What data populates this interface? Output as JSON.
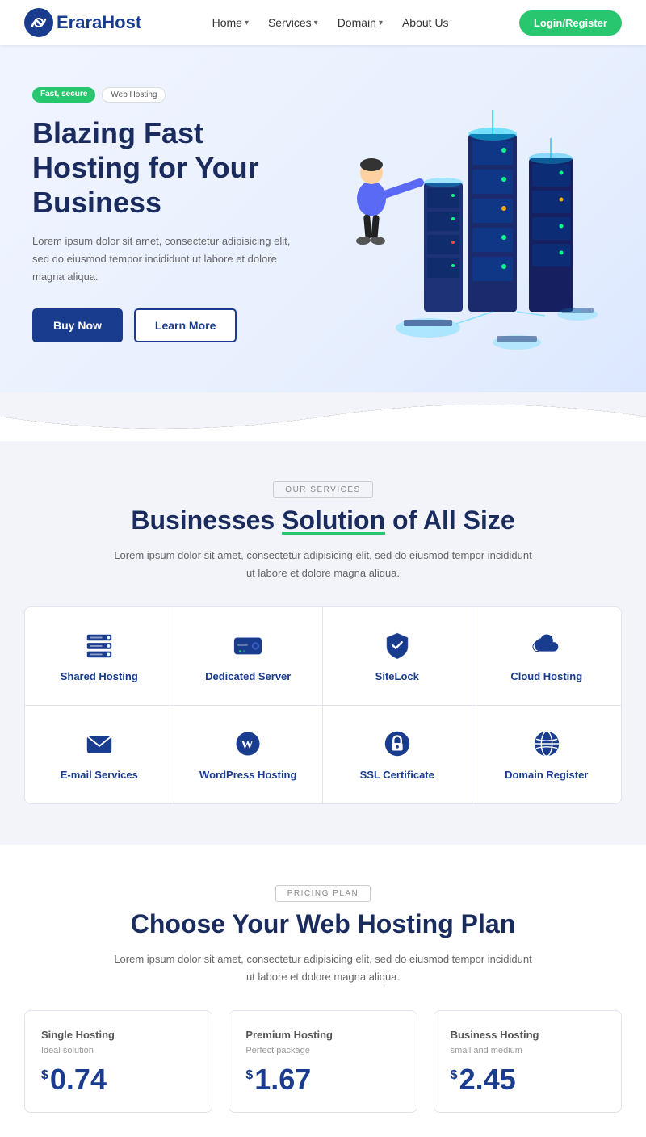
{
  "navbar": {
    "logo_text": "raHost",
    "nav_items": [
      {
        "label": "Home",
        "has_dropdown": true
      },
      {
        "label": "Services",
        "has_dropdown": true
      },
      {
        "label": "Domain",
        "has_dropdown": true
      },
      {
        "label": "About Us",
        "has_dropdown": false
      }
    ],
    "login_label": "Login/Register"
  },
  "hero": {
    "badge_fast": "Fast, secure",
    "badge_web": "Web Hosting",
    "title": "Blazing Fast Hosting for Your Business",
    "description": "Lorem ipsum dolor sit amet, consectetur adipisicing elit, sed do eiusmod tempor incididunt ut labore et dolore magna aliqua.",
    "btn_buy": "Buy Now",
    "btn_learn": "Learn More"
  },
  "services": {
    "section_label": "OUR SERVICES",
    "title_part1": "Businesses ",
    "title_highlight": "Solution",
    "title_part2": " of All Size",
    "description": "Lorem ipsum dolor sit amet, consectetur adipisicing elit, sed do eiusmod tempor incididunt ut labore et dolore magna aliqua.",
    "cards": [
      {
        "name": "Shared Hosting",
        "icon": "server"
      },
      {
        "name": "Dedicated Server",
        "icon": "hdd"
      },
      {
        "name": "SiteLock",
        "icon": "shield"
      },
      {
        "name": "Cloud Hosting",
        "icon": "cloud"
      },
      {
        "name": "E-mail Services",
        "icon": "envelope"
      },
      {
        "name": "WordPress Hosting",
        "icon": "wordpress"
      },
      {
        "name": "SSL Certificate",
        "icon": "lock"
      },
      {
        "name": "Domain Register",
        "icon": "globe"
      }
    ]
  },
  "pricing": {
    "section_label": "PRICING PLAN",
    "title": "Choose Your Web Hosting Plan",
    "description": "Lorem ipsum dolor sit amet, consectetur adipisicing elit, sed do eiusmod tempor incididunt ut labore et dolore magna aliqua.",
    "plans": [
      {
        "name": "Single Hosting",
        "sub": "Ideal solution",
        "currency": "$",
        "price": "0.74"
      },
      {
        "name": "Premium Hosting",
        "sub": "Perfect package",
        "currency": "$",
        "price": "1.67"
      },
      {
        "name": "Business Hosting",
        "sub": "small and medium",
        "currency": "$",
        "price": "2.45"
      }
    ]
  },
  "icons": {
    "server": "🖥",
    "hdd": "💾",
    "shield": "🛡",
    "cloud": "☁",
    "envelope": "✉",
    "wordpress": "W",
    "lock": "🔒",
    "globe": "🌐"
  },
  "colors": {
    "primary": "#1a3c8f",
    "accent": "#28c76f",
    "text_dark": "#1a2c5e",
    "text_muted": "#666",
    "bg_light": "#f2f4fa"
  }
}
